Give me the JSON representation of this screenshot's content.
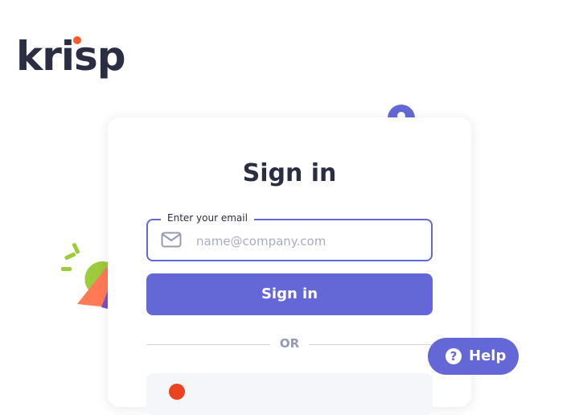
{
  "brand": {
    "logo_text": "krisp"
  },
  "signin": {
    "title": "Sign in",
    "email_label": "Enter your email",
    "email_placeholder": "name@company.com",
    "email_value": "",
    "submit_label": "Sign in",
    "divider_text": "OR"
  },
  "help": {
    "label": "Help",
    "icon_glyph": "?"
  },
  "colors": {
    "accent": "#6468d7",
    "text": "#2b2d42",
    "placeholder": "#a9acc8",
    "logo_dot": "#ff5a2d",
    "google_red": "#e9431f"
  },
  "icons": [
    "mail-icon",
    "help-icon",
    "google-icon"
  ]
}
